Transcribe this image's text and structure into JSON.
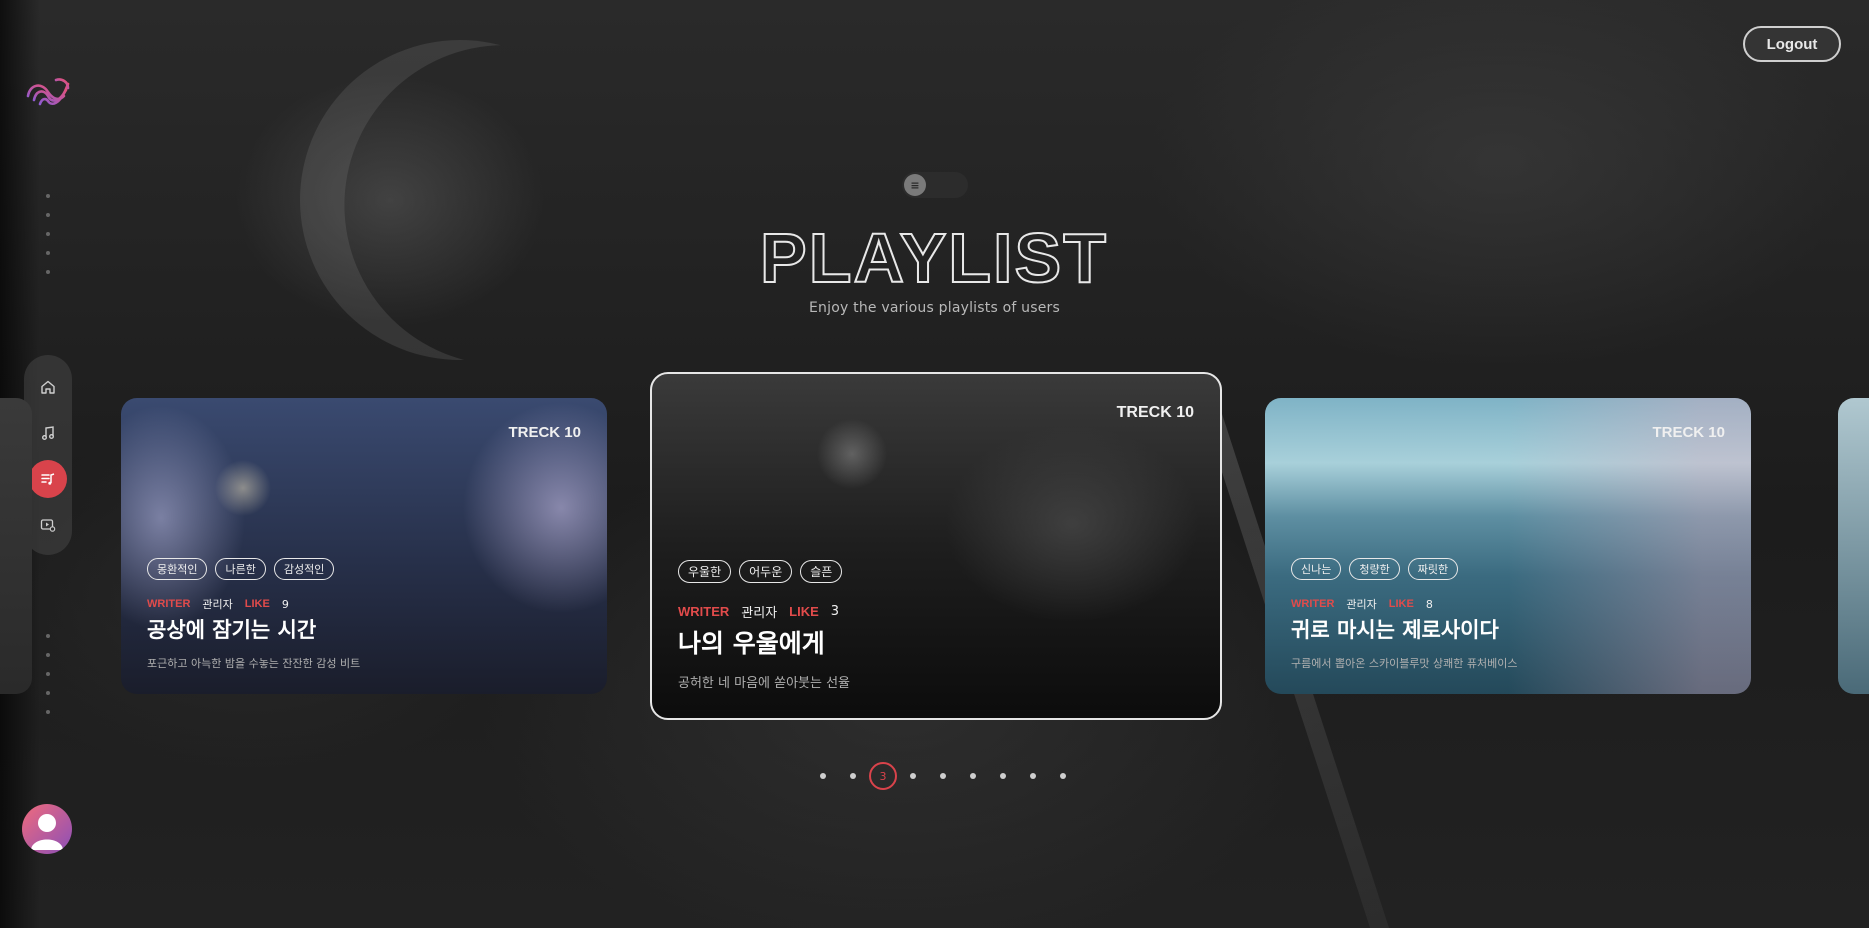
{
  "header": {
    "logout_label": "Logout"
  },
  "hero": {
    "title": "PLAYLIST",
    "subtitle": "Enjoy the various playlists of users",
    "toggle_icon": "≡"
  },
  "sidebar": {
    "items": [
      {
        "icon": "home-icon"
      },
      {
        "icon": "music-note-icon"
      },
      {
        "icon": "playlist-icon",
        "active": true
      },
      {
        "icon": "video-settings-icon"
      }
    ]
  },
  "cards": [
    {
      "treck": "TRECK 10",
      "tags": [
        "몽환적인",
        "나른한",
        "감성적인"
      ],
      "writer_label": "WRITER",
      "writer": "관리자",
      "like_label": "LIKE",
      "likes": "9",
      "title": "공상에 잠기는 시간",
      "description": "포근하고 아늑한 밤을 수놓는 잔잔한 감성 비트"
    },
    {
      "treck": "TRECK 10",
      "tags": [
        "우울한",
        "어두운",
        "슬픈"
      ],
      "writer_label": "WRITER",
      "writer": "관리자",
      "like_label": "LIKE",
      "likes": "3",
      "title": "나의 우울에게",
      "description": "공허한 네 마음에 쏟아붓는 선율"
    },
    {
      "treck": "TRECK 10",
      "tags": [
        "신나는",
        "청량한",
        "짜릿한"
      ],
      "writer_label": "WRITER",
      "writer": "관리자",
      "like_label": "LIKE",
      "likes": "8",
      "title": "귀로 마시는 제로사이다",
      "description": "구름에서 뽑아온 스카이블루맛 상쾌한 퓨처베이스"
    }
  ],
  "pagination": {
    "total": 9,
    "current": 3,
    "current_label": "3"
  },
  "colors": {
    "accent": "#d9434b",
    "like_red": "#e14b4b"
  }
}
